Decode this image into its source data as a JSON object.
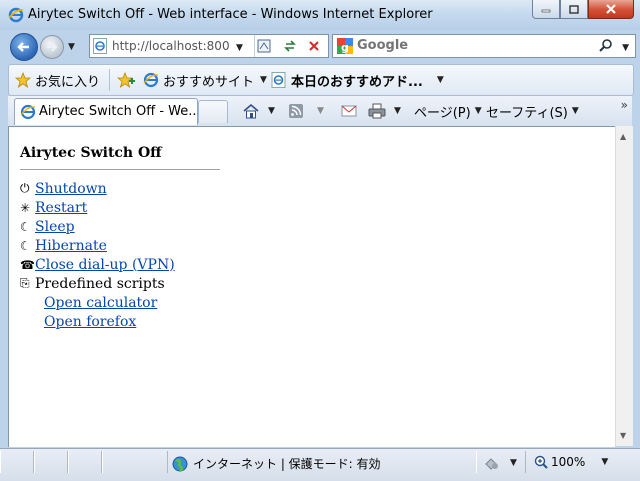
{
  "window": {
    "title": "Airytec Switch Off - Web interface - Windows Internet Explorer"
  },
  "address_bar": {
    "url": "http://localhost:800"
  },
  "search": {
    "provider": "Google"
  },
  "favorites_bar": {
    "favorites_label": "お気に入り",
    "items": [
      {
        "label": "おすすめサイト",
        "icon": "ie-page-icon"
      },
      {
        "label": "本日のおすすめアド...",
        "icon": "ie-page-icon"
      }
    ]
  },
  "tab": {
    "label": "Airytec Switch Off - We..."
  },
  "command_bar": {
    "page_menu": "ページ(P)",
    "safety_menu": "セーフティ(S)"
  },
  "page": {
    "heading": "Airytec Switch Off",
    "actions": [
      {
        "symbol": "⏻",
        "label": " Shutdown",
        "icon": "power-icon"
      },
      {
        "symbol": "✳",
        "label": " Restart",
        "icon": "restart-icon"
      },
      {
        "symbol": "☾",
        "label": " Sleep",
        "icon": "moon-icon"
      },
      {
        "symbol": "☾",
        "label": " Hibernate",
        "icon": "moon-icon"
      },
      {
        "symbol": "☎",
        "label": " Close dial-up (VPN)",
        "icon": "phone-icon"
      }
    ],
    "scripts_group": {
      "symbol": "⎘",
      "label": "Predefined scripts",
      "icon": "scripts-icon",
      "items": [
        {
          "label": "Open calculator"
        },
        {
          "label": "Open forefox"
        }
      ]
    }
  },
  "status_bar": {
    "zone": "インターネット | 保護モード: 有効",
    "zoom": "100%"
  },
  "colors": {
    "link": "#0645ad",
    "chrome": "#bcd3ea",
    "close_button": "#c4361a"
  }
}
